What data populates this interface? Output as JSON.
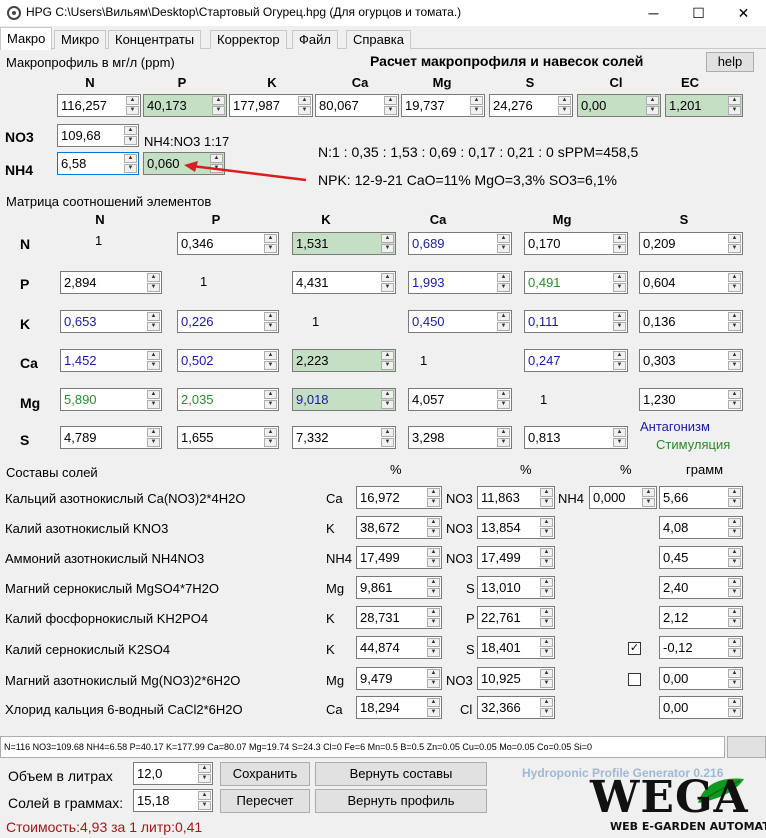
{
  "window": {
    "title": "HPG C:\\Users\\Вильям\\Desktop\\Стартовый Огурец.hpg (Для огурцов и томата.)"
  },
  "tabs": [
    "Макро",
    "Микро",
    "Концентраты",
    "Корректор",
    "Файл",
    "Справка"
  ],
  "macro": {
    "section_label": "Макропрофиль в мг/л (ppm)",
    "calc_title": "Расчет макропрофиля и навесок солей",
    "help_label": "help",
    "headers": [
      "N",
      "P",
      "K",
      "Ca",
      "Mg",
      "S",
      "Cl",
      "EC"
    ],
    "values": [
      "116,257",
      "40,173",
      "177,987",
      "80,067",
      "19,737",
      "24,276",
      "0,00",
      "1,201"
    ],
    "no3_label": "NO3",
    "no3_value": "109,68",
    "nh4_label": "NH4",
    "nh4_value": "6,58",
    "nh4_ratio_value": "0,060",
    "ratio_text": "NH4:NO3 1:17",
    "ratio_line": "N:1 : 0,35 : 1,53 : 0,69 : 0,17 : 0,21 : 0 sPPM=458,5",
    "npk_line": "NPK: 12-9-21 CaO=11% MgO=3,3% SO3=6,1%"
  },
  "matrix": {
    "title": "Матрица соотношений элементов",
    "headers": [
      "N",
      "P",
      "K",
      "Ca",
      "Mg",
      "S"
    ],
    "rows": [
      {
        "label": "N",
        "cells": [
          "1",
          "0,346",
          "1,531",
          "0,689",
          "0,170",
          "0,209"
        ]
      },
      {
        "label": "P",
        "cells": [
          "2,894",
          "1",
          "4,431",
          "1,993",
          "0,491",
          "0,604"
        ]
      },
      {
        "label": "K",
        "cells": [
          "0,653",
          "0,226",
          "1",
          "0,450",
          "0,111",
          "0,136"
        ]
      },
      {
        "label": "Ca",
        "cells": [
          "1,452",
          "0,502",
          "2,223",
          "1",
          "0,247",
          "0,303"
        ]
      },
      {
        "label": "Mg",
        "cells": [
          "5,890",
          "2,035",
          "9,018",
          "4,057",
          "1",
          "1,230"
        ]
      },
      {
        "label": "S",
        "cells": [
          "4,789",
          "1,655",
          "7,332",
          "3,298",
          "0,813",
          "1"
        ]
      }
    ],
    "legend_antagonism": "Антагонизм",
    "legend_stimulation": "Стимуляция"
  },
  "salts": {
    "title": "Составы солей",
    "percent_label": "%",
    "gram_label": "грамм",
    "rows": [
      {
        "name": "Кальций азотнокислый Ca(NO3)2*4H2O",
        "el1": "Ca",
        "pct1": "16,972",
        "el2": "NO3",
        "pct2": "11,863",
        "grams": "5,66"
      },
      {
        "name": "Калий азотнокислый KNO3",
        "el1": "K",
        "pct1": "38,672",
        "el2": "NO3",
        "pct2": "13,854",
        "grams": "4,08"
      },
      {
        "name": "Аммоний азотнокислый NH4NO3",
        "el1": "NH4",
        "pct1": "17,499",
        "el2": "NO3",
        "pct2": "17,499",
        "grams": "0,45"
      },
      {
        "name": "Магний сернокислый MgSO4*7H2O",
        "el1": "Mg",
        "pct1": "9,861",
        "el2": "S",
        "pct2": "13,010",
        "grams": "2,40"
      },
      {
        "name": "Калий фосфорнокислый KH2PO4",
        "el1": "K",
        "pct1": "28,731",
        "el2": "P",
        "pct2": "22,761",
        "grams": "2,12"
      },
      {
        "name": "Калий сернокислый K2SO4",
        "el1": "K",
        "pct1": "44,874",
        "el2": "S",
        "pct2": "18,401",
        "grams": "-0,12"
      },
      {
        "name": "Магний азотнокислый Mg(NO3)2*6H2O",
        "el1": "Mg",
        "pct1": "9,479",
        "el2": "NO3",
        "pct2": "10,925",
        "grams": "0,00"
      },
      {
        "name": "Хлорид кальция 6-водный CaCl2*6H2O",
        "el1": "Ca",
        "pct1": "18,294",
        "el2": "Cl",
        "pct2": "32,366",
        "grams": "0,00"
      }
    ],
    "nh4_label": "NH4",
    "nh4_pct": "0,000",
    "k2so4_checked": "✓",
    "mgno3_checked": ""
  },
  "status": {
    "text": "N=116 NO3=109.68 NH4=6.58 P=40.17 K=177.99 Ca=80.07 Mg=19.74 S=24.3 Cl=0 Fe=6 Mn=0.5 B=0.5 Zn=0.05 Cu=0.05 Mo=0.05 Co=0.05 Si=0"
  },
  "bottom": {
    "volume_label": "Объем в литрах",
    "volume_value": "12,0",
    "salts_label": "Солей в граммах:",
    "salts_value": "15,18",
    "save_button": "Сохранить",
    "restore_compositions_button": "Вернуть составы",
    "recalc_button": "Пересчет",
    "restore_profile_button": "Вернуть профиль",
    "cost_text": "Стоимость:4,93 за 1 литр:0,41",
    "brand_text": "Hydroponic Profile Generator 0.216",
    "logo_text": "WEGA",
    "logo_sub": "WEB E-GARDEN AUTOMATION"
  },
  "colors": {
    "green_cell": "#c4dfc4",
    "blue_text": "#1a1aa6",
    "green_text": "#2b8a2b",
    "red_text": "#a0191a",
    "arrow": "#d42020"
  }
}
